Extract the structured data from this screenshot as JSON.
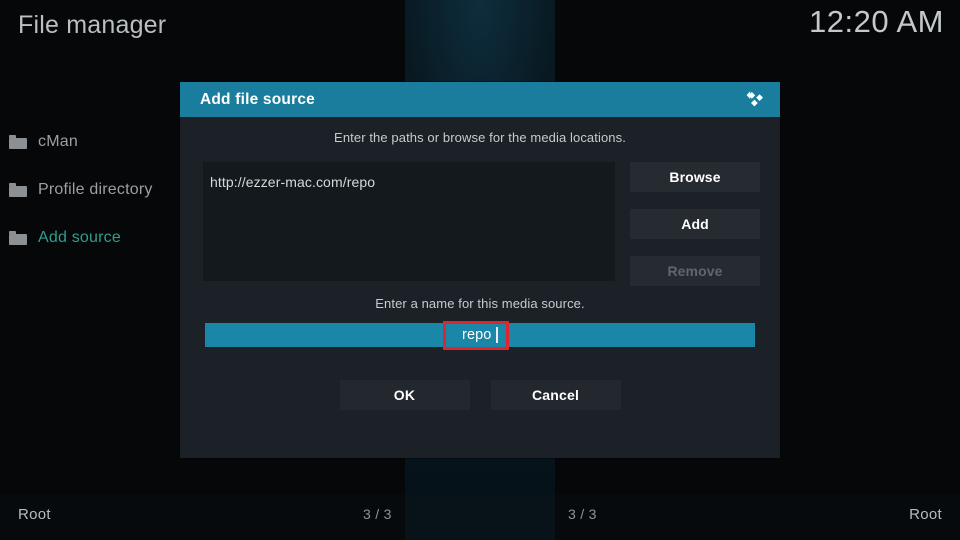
{
  "header": {
    "title": "File manager",
    "clock": "12:20 AM"
  },
  "sidebar": {
    "items": [
      {
        "label": "cMan",
        "icon": "folder-icon",
        "active": false
      },
      {
        "label": "Profile directory",
        "icon": "folder-icon",
        "active": false
      },
      {
        "label": "Add source",
        "icon": "folder-icon",
        "active": true
      }
    ]
  },
  "dialog": {
    "title": "Add file source",
    "logo_icon": "kodi-logo-icon",
    "paths_hint": "Enter the paths or browse for the media locations.",
    "path_value": "http://ezzer-mac.com/repo",
    "buttons": {
      "browse": "Browse",
      "add": "Add",
      "remove": "Remove"
    },
    "name_hint": "Enter a name for this media source.",
    "name_value": "repo",
    "actions": {
      "ok": "OK",
      "cancel": "Cancel"
    }
  },
  "footer": {
    "left_path": "Root",
    "left_count": "3 / 3",
    "right_count": "3 / 3",
    "right_path": "Root"
  },
  "colors": {
    "accent_teal": "#1a7d9e",
    "field_teal": "#1a86a8",
    "highlight_green": "#2e9e8f",
    "annotation_red": "#e0262b",
    "dialog_bg": "#1b2127"
  }
}
